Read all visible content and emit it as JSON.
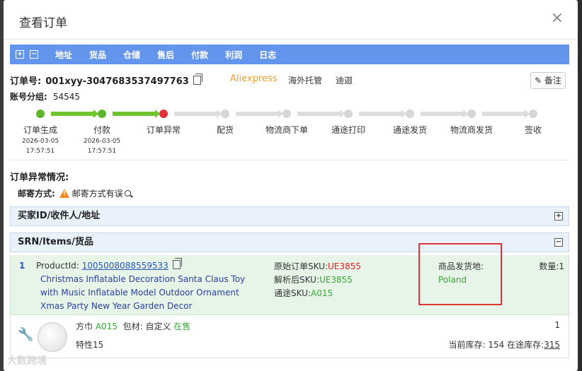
{
  "dialog": {
    "title": "查看订单",
    "close": "×"
  },
  "toolbar": {
    "expand": "+",
    "collapse": "−",
    "items": [
      "地址",
      "货品",
      "仓储",
      "售后",
      "付款",
      "利润",
      "日志"
    ]
  },
  "order": {
    "number_label": "订单号:",
    "number": "001xyy-3047683537497763",
    "platform": "Aliexpress",
    "tags": [
      "海外托管",
      "迪迦"
    ],
    "note_button": "备注",
    "account_label": "账号分组:",
    "account": "54545"
  },
  "progress": {
    "steps": [
      {
        "name": "订单生成",
        "date": "2026-03-05",
        "time": "17:57:51",
        "status": "done"
      },
      {
        "name": "付款",
        "date": "2026-03-05",
        "time": "17:57:51",
        "status": "done"
      },
      {
        "name": "订单异常",
        "date": "",
        "time": "",
        "status": "error"
      },
      {
        "name": "配货",
        "date": "",
        "time": "",
        "status": "pending"
      },
      {
        "name": "物流商下单",
        "date": "",
        "time": "",
        "status": "pending"
      },
      {
        "name": "通途打印",
        "date": "",
        "time": "",
        "status": "pending"
      },
      {
        "name": "通途发货",
        "date": "",
        "time": "",
        "status": "pending"
      },
      {
        "name": "物流商发货",
        "date": "",
        "time": "",
        "status": "pending"
      },
      {
        "name": "签收",
        "date": "",
        "time": "",
        "status": "pending"
      }
    ]
  },
  "exception": {
    "title": "订单异常情况:",
    "label": "邮寄方式:",
    "message": "邮寄方式有误"
  },
  "panels": {
    "buyer": "买家ID/收件人/地址",
    "items": "SRN/Items/货品"
  },
  "item": {
    "index": "1",
    "product_id_label": "ProductId:",
    "product_id": "1005008088559533",
    "title": "Christmas Inflatable Decoration Santa Claus Toy with Music Inflatable Model Outdoor Ornament Xmas Party New Year Garden Decor",
    "sku_orig_label": "原始订单SKU:",
    "sku_orig": "UE3855",
    "sku_parsed_label": "解析后SKU:",
    "sku_parsed": "UE3855",
    "sku_tt_label": "通途SKU:",
    "sku_tt": "A015",
    "ship_from_label": "商品发货地:",
    "ship_from": "Poland",
    "qty_label": "数量:1",
    "name_prefix": "方巾",
    "name_sku": "A015",
    "packaging": "包材: 自定义",
    "status": "在售",
    "attr": "特性15",
    "qty_value": "1",
    "stock_label": "当前库存: 154 在途库存:",
    "stock_transit": "315"
  },
  "watermark": "大数跨境"
}
